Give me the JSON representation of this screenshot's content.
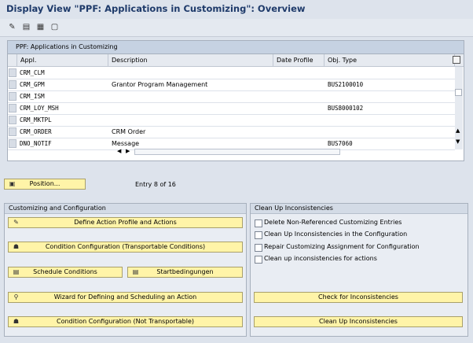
{
  "window": {
    "title": "Display View \"PPF: Applications in Customizing\": Overview"
  },
  "toolbar": {
    "icons": [
      "edit-pencil-icon",
      "details-icon",
      "select-all-icon",
      "deselect-icon"
    ]
  },
  "table": {
    "title": "PPF: Applications in Customizing",
    "columns": [
      "Appl.",
      "Description",
      "Date Profile",
      "Obj. Type"
    ],
    "rows": [
      {
        "appl": "CRM_CLM",
        "desc": "",
        "date": "",
        "obj": ""
      },
      {
        "appl": "CRM_GPM",
        "desc": "Grantor Program Management",
        "date": "",
        "obj": "BUS2100010"
      },
      {
        "appl": "CRM_ISM",
        "desc": "",
        "date": "",
        "obj": ""
      },
      {
        "appl": "CRM_LOY_MSH",
        "desc": "",
        "date": "",
        "obj": "BUS8000102"
      },
      {
        "appl": "CRM_MKTPL",
        "desc": "",
        "date": "",
        "obj": ""
      },
      {
        "appl": "CRM_ORDER",
        "desc": "CRM Order",
        "date": "",
        "obj": ""
      },
      {
        "appl": "DNO_NOTIF",
        "desc": "Message",
        "date": "",
        "obj": "BUS7060"
      }
    ]
  },
  "position": {
    "button_label": "Position...",
    "entry_text": "Entry 8 of 16"
  },
  "customizing": {
    "title": "Customizing and Configuration",
    "define_action": "Define Action Profile and Actions",
    "condition_transportable": "Condition Configuration (Transportable Conditions)",
    "schedule_conditions": "Schedule Conditions",
    "startbedingungen": "Startbedingungen",
    "wizard": "Wizard for Defining and Scheduling an Action",
    "condition_not_transportable": "Condition Configuration (Not Transportable)"
  },
  "cleanup": {
    "title": "Clean Up Inconsistencies",
    "options": [
      "Delete Non-Referenced Customizing Entries",
      "Clean Up Inconsistencies in the Configuration",
      "Repair Customizing Assignment for Configuration",
      "Clean up inconsistencies for actions"
    ],
    "check_button": "Check for Inconsistencies",
    "cleanup_button": "Clean Up Inconsistencies"
  }
}
